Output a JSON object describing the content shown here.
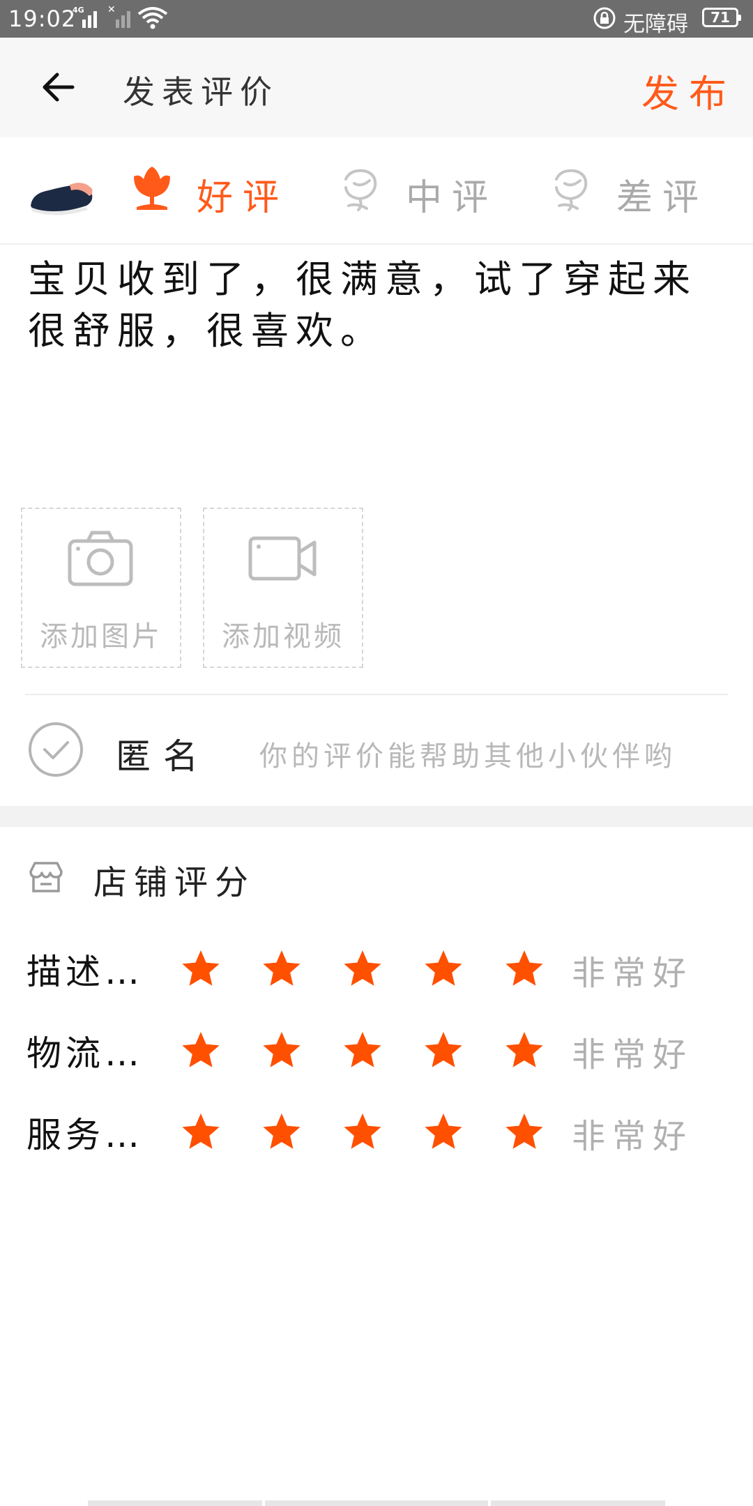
{
  "status_bar": {
    "time": "19:02",
    "network_tag": "4G",
    "accessibility_text": "无障碍",
    "battery": "71"
  },
  "header": {
    "back_icon": "arrow-left-icon",
    "title": "发表评价",
    "publish_label": "发布",
    "accent_color": "#ff5a1a"
  },
  "rating_tabs": {
    "selected": "好评",
    "items": [
      {
        "label": "好评",
        "icon": "flower-icon",
        "active": true
      },
      {
        "label": "中评",
        "icon": "flower-outline-icon",
        "active": false
      },
      {
        "label": "差评",
        "icon": "flower-outline-icon",
        "active": false
      }
    ]
  },
  "review": {
    "text": "宝贝收到了，很满意，试了穿起来很舒服，很喜欢。"
  },
  "media": {
    "add_photo_label": "添加图片",
    "add_video_label": "添加视频"
  },
  "anonymous": {
    "label": "匿名",
    "hint": "你的评价能帮助其他小伙伴哟",
    "checked": false
  },
  "store_rating": {
    "title": "店铺评分",
    "star_color": "#ff5000",
    "rows": [
      {
        "label": "描述…",
        "stars": 5,
        "value_text": "非常好"
      },
      {
        "label": "物流…",
        "stars": 5,
        "value_text": "非常好"
      },
      {
        "label": "服务…",
        "stars": 5,
        "value_text": "非常好"
      }
    ]
  }
}
